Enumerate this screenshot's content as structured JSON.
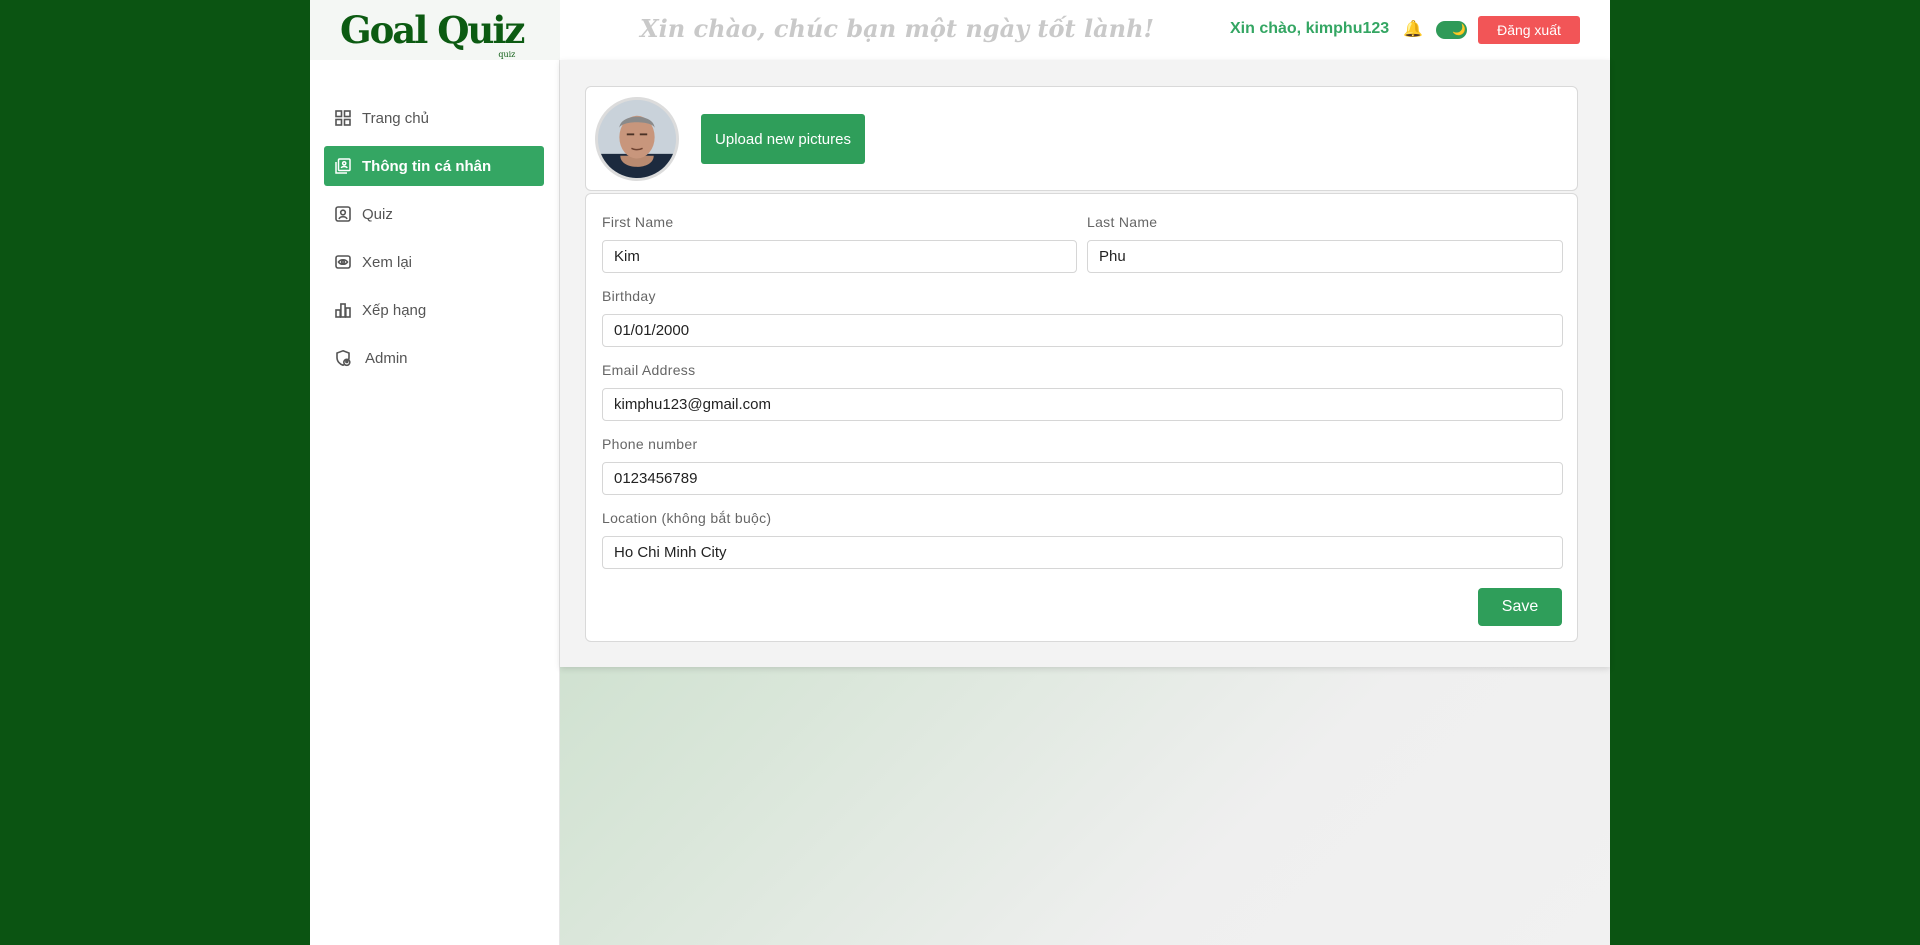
{
  "app": {
    "logo_text": "Goal Quiz",
    "logo_sub": "quiz"
  },
  "header": {
    "welcome": "Xin chào, chúc bạn một ngày tốt lành!",
    "greeting": "Xin chào, kimphu123",
    "bell_icon": "🔔",
    "theme_icon": "🌙",
    "logout_label": "Đăng xuất"
  },
  "sidebar": {
    "items": [
      {
        "label": "Trang chủ",
        "icon": "grid-icon",
        "active": false
      },
      {
        "label": "Thông tin cá nhân",
        "icon": "profile-book-icon",
        "active": true
      },
      {
        "label": "Quiz",
        "icon": "user-square-icon",
        "active": false
      },
      {
        "label": "Xem lại",
        "icon": "eye-icon",
        "active": false
      },
      {
        "label": "Xếp hạng",
        "icon": "bar-chart-icon",
        "active": false
      },
      {
        "label": "Admin",
        "icon": "shield-user-icon",
        "active": false
      }
    ]
  },
  "profile": {
    "upload_label": "Upload new pictures",
    "first_name_label": "First Name",
    "first_name": "Kim",
    "last_name_label": "Last Name",
    "last_name": "Phu",
    "birthday_label": "Birthday",
    "birthday": "01/01/2000",
    "email_label": "Email Address",
    "email": "kimphu123@gmail.com",
    "phone_label": "Phone number",
    "phone": "0123456789",
    "location_label": "Location (không bắt buộc)",
    "location": "Ho Chi Minh City",
    "save_label": "Save"
  },
  "colors": {
    "accent": "#34a663",
    "outer_bg": "#0b5412",
    "logout": "#f25557"
  }
}
